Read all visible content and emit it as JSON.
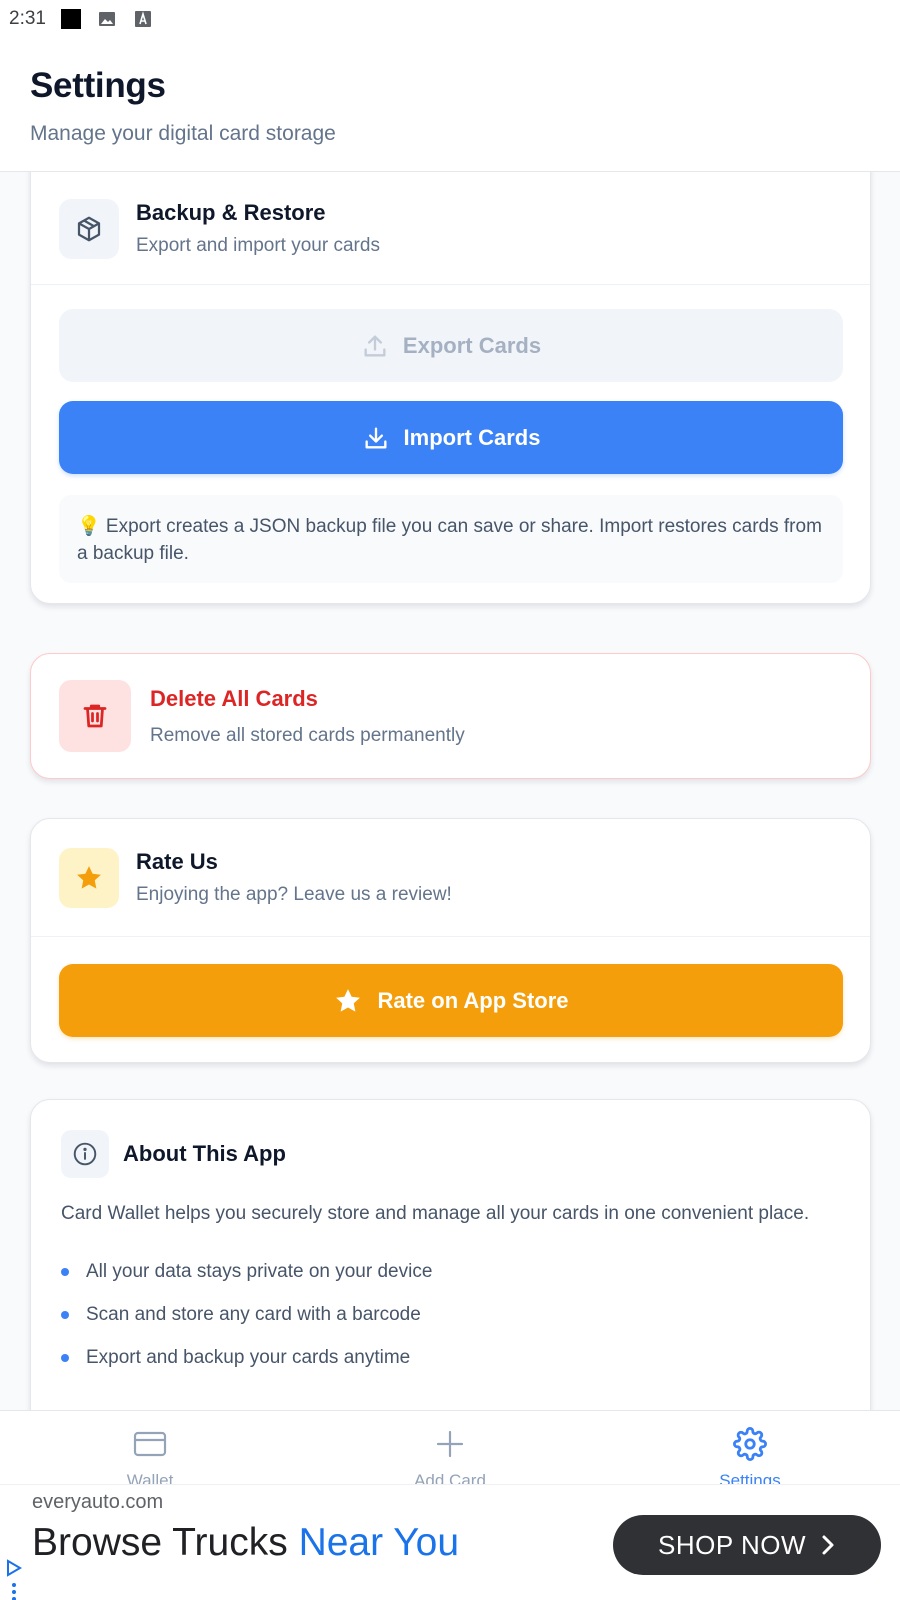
{
  "status_bar": {
    "time": "2:31"
  },
  "header": {
    "title": "Settings",
    "subtitle": "Manage your digital card storage"
  },
  "backup": {
    "title": "Backup & Restore",
    "description": "Export and import your cards",
    "export_label": "Export Cards",
    "import_label": "Import Cards",
    "tip": "💡 Export creates a JSON backup file you can save or share. Import restores cards from a backup file."
  },
  "delete_all": {
    "title": "Delete All Cards",
    "description": "Remove all stored cards permanently"
  },
  "rate": {
    "title": "Rate Us",
    "description": "Enjoying the app? Leave us a review!",
    "button_label": "Rate on App Store"
  },
  "about": {
    "title": "About This App",
    "body": "Card Wallet helps you securely store and manage all your cards in one convenient place.",
    "features": [
      "All your data stays private on your device",
      "Scan and store any card with a barcode",
      "Export and backup your cards anytime"
    ]
  },
  "tabs": [
    {
      "label": "Wallet",
      "icon": "card-icon",
      "active": false
    },
    {
      "label": "Add Card",
      "icon": "plus-icon",
      "active": false
    },
    {
      "label": "Settings",
      "icon": "gear-icon",
      "active": true
    }
  ],
  "ad": {
    "domain": "everyauto.com",
    "headline_part1": "Browse Trucks ",
    "headline_part2": "Near You",
    "cta": "SHOP NOW"
  },
  "colors": {
    "accent": "#3b82f6",
    "danger": "#dc2626",
    "warning": "#f59e0b",
    "text_primary": "#0f172a",
    "text_secondary": "#64748b"
  }
}
